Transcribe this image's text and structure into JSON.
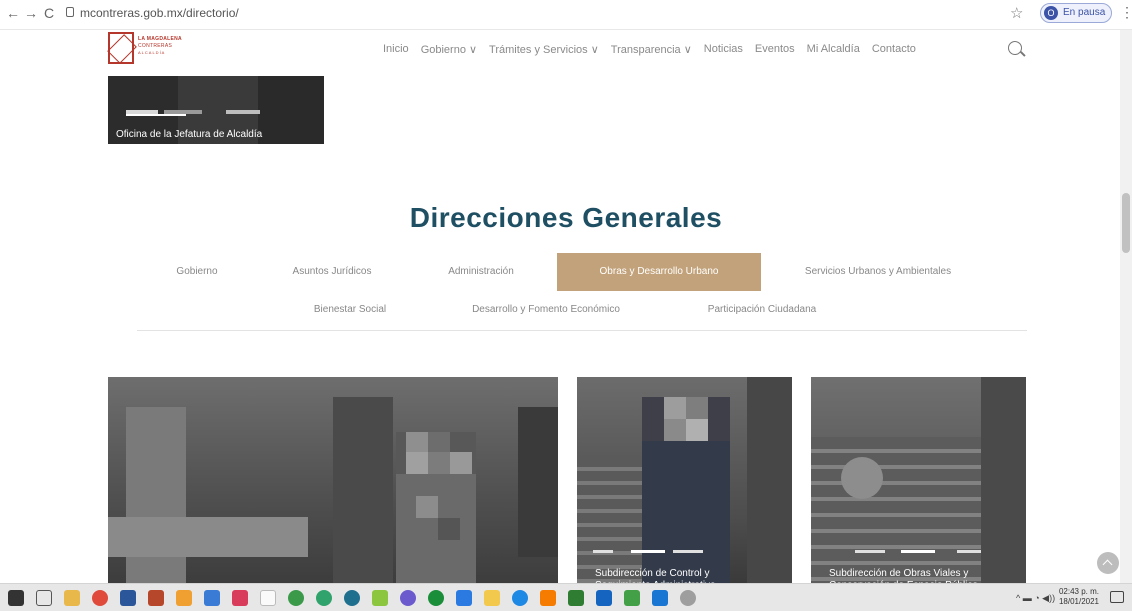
{
  "browser": {
    "url": "mcontreras.gob.mx/directorio/",
    "profile_initial": "O",
    "profile_label": "En pausa"
  },
  "logo": {
    "line1": "LA MAGDALENA",
    "line2": "CONTRERAS",
    "line3": "ALCALDÍA"
  },
  "nav": {
    "items": [
      "Inicio",
      "Gobierno ∨",
      "Trámites y Servicios ∨",
      "Transparencia ∨",
      "Noticias",
      "Eventos",
      "Mi Alcaldía",
      "Contacto"
    ]
  },
  "top_card": {
    "caption": "Oficina de la Jefatura de Alcaldía"
  },
  "section": {
    "title": "Direcciones Generales",
    "tabs_row1": [
      "Gobierno",
      "Asuntos Jurídicos",
      "Administración",
      "Obras y Desarrollo Urbano",
      "Servicios Urbanos y Ambientales"
    ],
    "tabs_row2": [
      "Bienestar Social",
      "Desarrollo y Fomento Económico",
      "Participación Ciudadana"
    ],
    "active_tab": "Obras y Desarrollo Urbano"
  },
  "cards": {
    "card2_caption": "Subdirección de Control y Seguimiento Administrativo",
    "card3_caption": "Subdirección de Obras Viales y Conservación de Espacio Público"
  },
  "taskbar": {
    "time": "02:43 p. m.",
    "date": "18/01/2021"
  },
  "colors": {
    "accent": "#c2a27a",
    "title": "#1f4f63",
    "brand": "#b5362b"
  }
}
